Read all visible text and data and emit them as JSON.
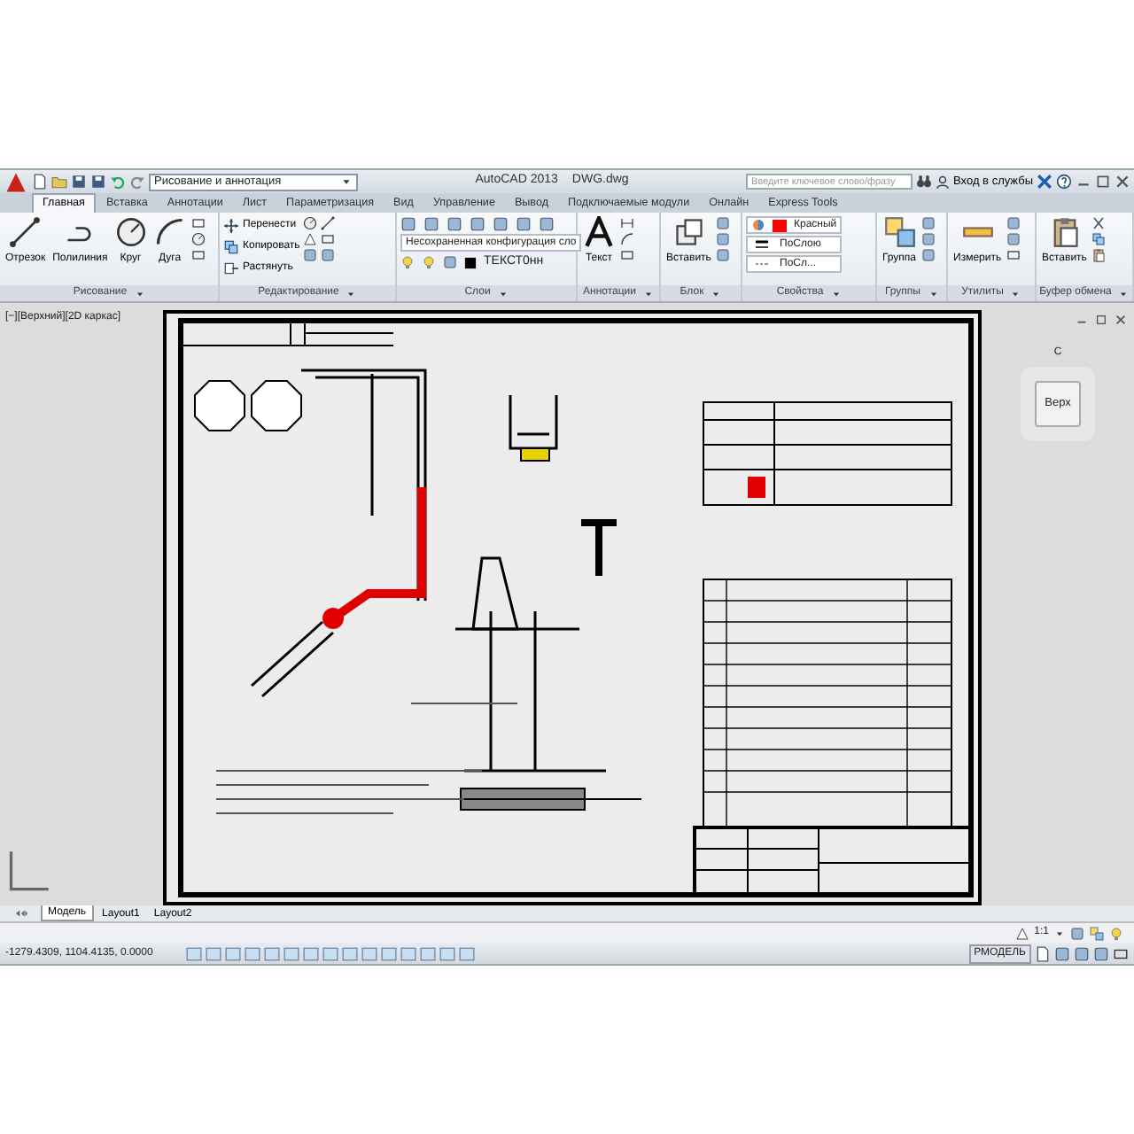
{
  "window": {
    "title": "AutoCAD 2013",
    "file": "DWG.dwg"
  },
  "workspace": "Рисование и аннотация",
  "search": {
    "placeholder": "Введите ключевое слово/фразу"
  },
  "sign_in": "Вход в службы",
  "tabs": [
    {
      "label": "Главная",
      "selected": true
    },
    {
      "label": "Вставка",
      "selected": false
    },
    {
      "label": "Аннотации",
      "selected": false
    },
    {
      "label": "Лист",
      "selected": false
    },
    {
      "label": "Параметризация",
      "selected": false
    },
    {
      "label": "Вид",
      "selected": false
    },
    {
      "label": "Управление",
      "selected": false
    },
    {
      "label": "Вывод",
      "selected": false
    },
    {
      "label": "Подключаемые модули",
      "selected": false
    },
    {
      "label": "Онлайн",
      "selected": false
    },
    {
      "label": "Express Tools",
      "selected": false
    }
  ],
  "panels": [
    {
      "kind": "draw",
      "title": "Рисование",
      "large": [
        "Отрезок",
        "Полилиния",
        "Круг",
        "Дуга"
      ]
    },
    {
      "kind": "modify",
      "title": "Редактирование",
      "small": [
        "Перенести",
        "Копировать",
        "Растянуть"
      ]
    },
    {
      "kind": "layers",
      "title": "Слои",
      "layer_state": "Несохраненная конфигурация сло",
      "layer": "ТЕКСТ0нн"
    },
    {
      "kind": "annotation",
      "title": "Аннотации",
      "large": [
        "Текст"
      ]
    },
    {
      "kind": "block",
      "title": "Блок",
      "large": [
        "Вставить"
      ]
    },
    {
      "kind": "properties",
      "title": "Свойства",
      "color_name": "Красный",
      "color": "#ff0000",
      "lineweight": "ПоСлою",
      "linetype": "ПоСл..."
    },
    {
      "kind": "groups",
      "title": "Группы",
      "large": [
        "Группа"
      ]
    },
    {
      "kind": "utilities",
      "title": "Утилиты",
      "large": [
        "Измерить"
      ]
    },
    {
      "kind": "clipboard",
      "title": "Буфер обмена",
      "large": [
        "Вставить"
      ]
    }
  ],
  "viewport": {
    "label": "[−][Верхний][2D каркас]",
    "viewcube_face": "Верх",
    "compass": "С"
  },
  "layout_tabs": [
    {
      "label": "Модель",
      "selected": true
    },
    {
      "label": "Layout1",
      "selected": false
    },
    {
      "label": "Layout2",
      "selected": false
    }
  ],
  "annotation_scale": "1:1",
  "status": {
    "coordinates": "-1279.4309, 1104.4135, 0.0000",
    "space": "РМОДЕЛЬ"
  }
}
